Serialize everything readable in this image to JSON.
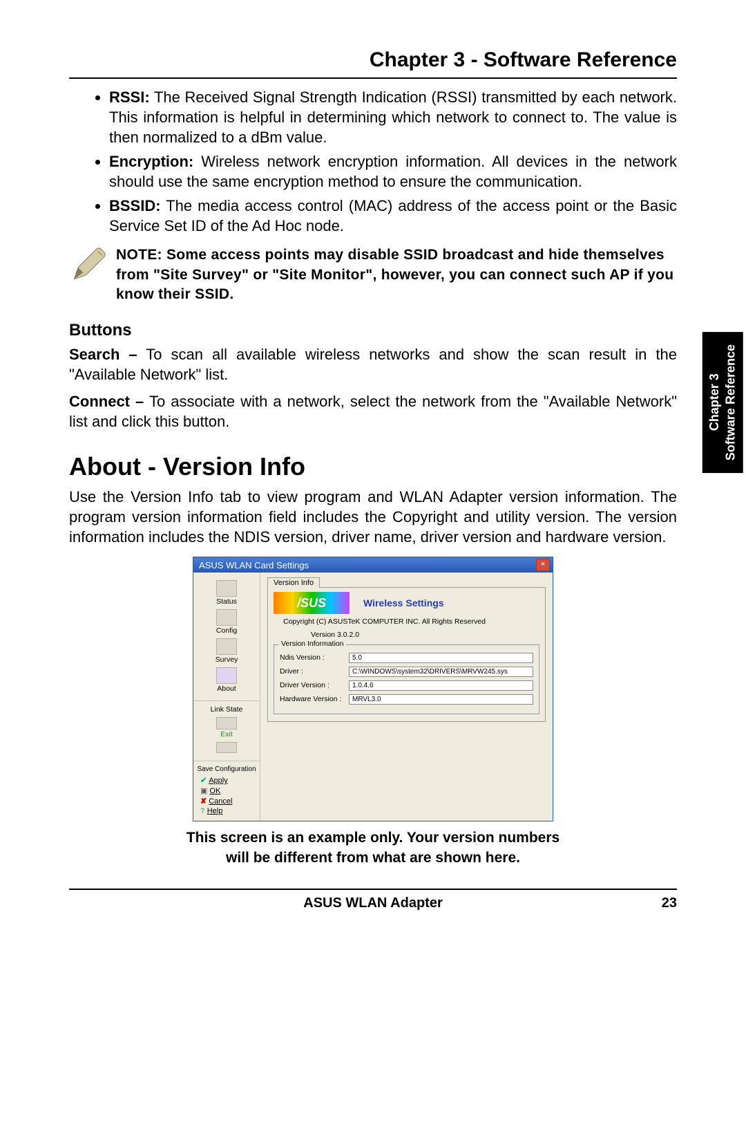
{
  "header": {
    "chapter_title": "Chapter 3 - Software Reference"
  },
  "sidetab": {
    "line1": "Chapter 3",
    "line2": "Software Reference"
  },
  "bullets": {
    "rssi_label": "RSSI:",
    "rssi_text": " The Received Signal Strength Indication (RSSI) transmitted by each network. This information is helpful in determining which network to connect to. The value is then normalized to a dBm value.",
    "enc_label": "Encryption:",
    "enc_text": " Wireless network encryption information. All devices in the network should use the same encryption method to ensure the communication.",
    "bssid_label": "BSSID:",
    "bssid_text": " The media access control (MAC) address of the access point or the Basic Service Set ID of the Ad Hoc node."
  },
  "note": {
    "text": "NOTE: Some access points may disable SSID broadcast and hide themselves from \"Site Survey\" or \"Site Monitor\", however, you can connect such AP if you know their SSID."
  },
  "buttons_section": {
    "title": "Buttons",
    "search_label": "Search –",
    "search_text": " To scan all available wireless networks and show the scan result in the \"Available Network\" list.",
    "connect_label": "Connect –",
    "connect_text": " To associate with a network, select the network from the \"Available Network\" list and click this button."
  },
  "about": {
    "title": "About - Version Info",
    "para": "Use the Version Info tab to view program and WLAN Adapter version information. The program version information field includes the Copyright and utility version. The version information includes the NDIS version, driver name, driver version and hardware version."
  },
  "dialog": {
    "title": "ASUS WLAN Card Settings",
    "tab": "Version Info",
    "wireless": "Wireless Settings",
    "logo_text": "/SUS",
    "copyright": "Copyright (C) ASUSTeK COMPUTER INC. All Rights Reserved",
    "version_line": "Version 3.0.2.0",
    "fieldset_label": "Version Information",
    "fields": {
      "ndis_label": "Ndis Version :",
      "ndis_value": "5.0",
      "driver_label": "Driver :",
      "driver_value": "C:\\WINDOWS\\system32\\DRIVERS\\MRVW245.sys",
      "drv_ver_label": "Driver Version :",
      "drv_ver_value": "1.0.4.6",
      "hw_ver_label": "Hardware Version :",
      "hw_ver_value": "MRVL3.0"
    },
    "nav": {
      "status": "Status",
      "config": "Config",
      "survey": "Survey",
      "about": "About",
      "linkstate": "Link State",
      "exit": "Exit",
      "saveconf": "Save Configuration",
      "apply": "Apply",
      "ok": "OK",
      "cancel": "Cancel",
      "help": "Help"
    }
  },
  "caption": {
    "line1": "This screen is an example only. Your version numbers",
    "line2": "will be different from what are shown here."
  },
  "footer": {
    "product": "ASUS WLAN Adapter",
    "page": "23"
  }
}
